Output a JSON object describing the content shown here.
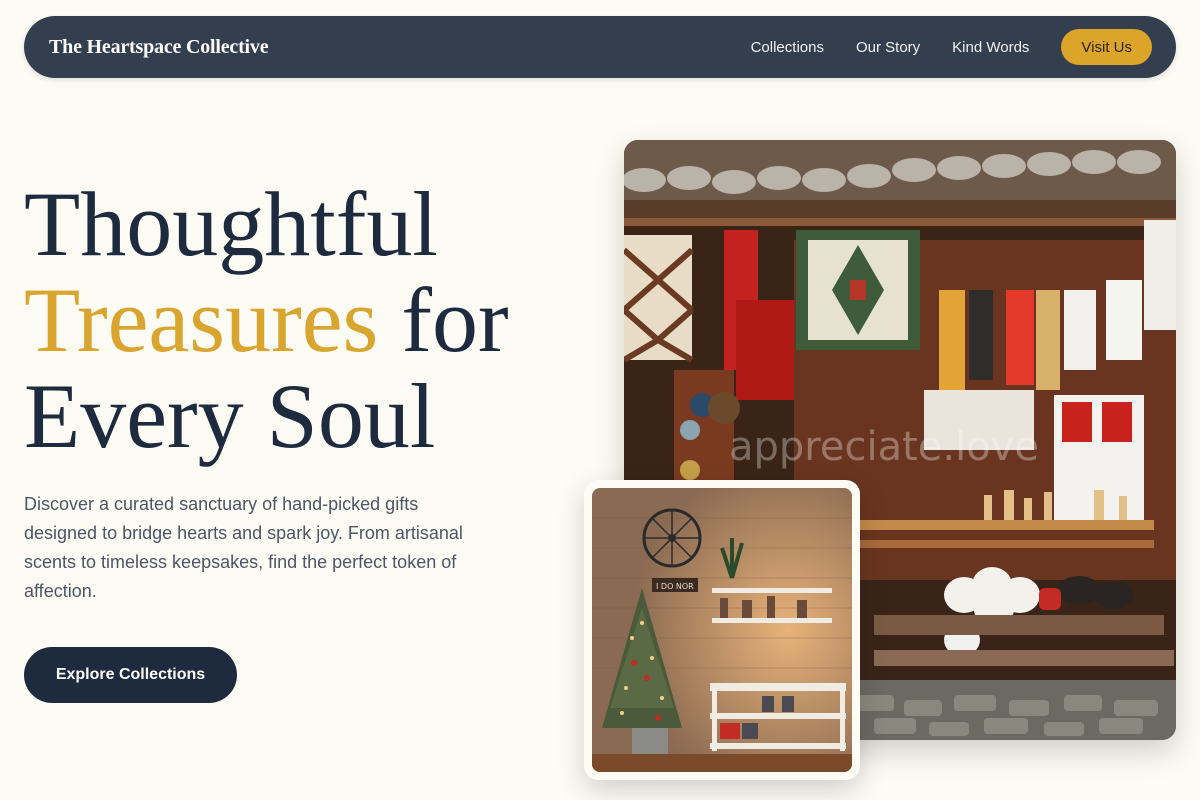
{
  "nav": {
    "brand": "The Heartspace Collective",
    "links": [
      "Collections",
      "Our Story",
      "Kind Words"
    ],
    "cta": "Visit Us"
  },
  "hero": {
    "line1": "Thoughtful",
    "line2_accent": "Treasures",
    "line2_rest": " for",
    "line3": "Every Soul",
    "lead": "Discover a curated sanctuary of hand-picked gifts designed to bridge hearts and spark joy. From artisanal scents to timeless keepsakes, find the perfect token of affection.",
    "cta": "Explore Collections"
  },
  "images": {
    "main_alt": "Market stall with hanging textiles and crafts",
    "main_watermark": "appreciate.love",
    "inset_alt": "Cozy shop corner with Christmas tree and shelves",
    "inset_sign": "I DO NOR"
  },
  "colors": {
    "background": "#fdfcf4",
    "nav": "#333f4f",
    "accent": "#d9a52e",
    "navy": "#1e2a3e"
  }
}
